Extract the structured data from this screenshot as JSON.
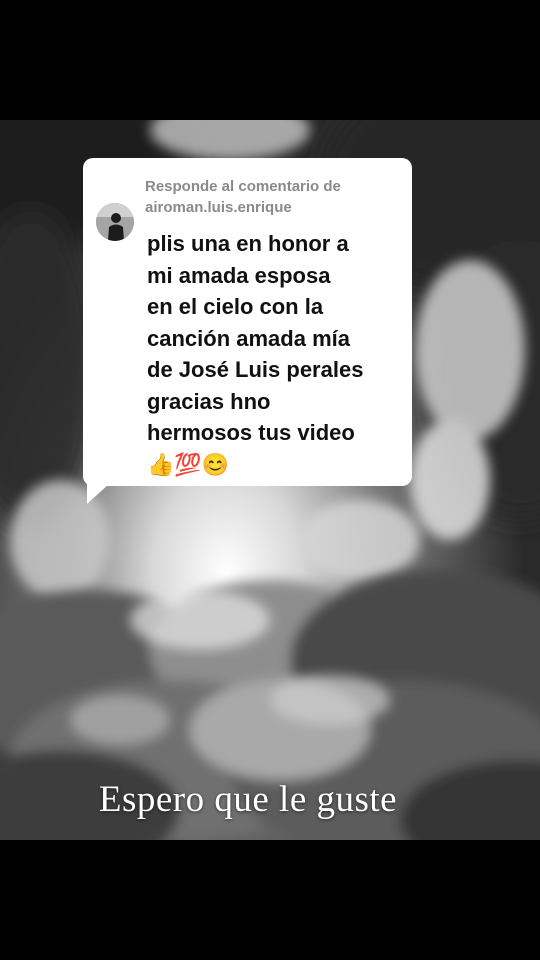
{
  "reply": {
    "header_line1": "Responde al comentario de",
    "header_line2": "airoman.luis.enrique",
    "comment_lines": [
      "plis una en honor a",
      "mi amada esposa",
      "en el cielo con la",
      "canción amada mía",
      "de José Luis perales",
      "gracias hno",
      "hermosos tus video",
      "👍💯😊"
    ]
  },
  "caption": "Espero que le guste",
  "icons": {
    "avatar": "user-avatar-icon"
  },
  "colors": {
    "card_background": "#ffffff",
    "header_text": "#8a8a8a",
    "comment_text": "#111111",
    "caption_text": "#ffffff",
    "letterbox": "#000000"
  }
}
